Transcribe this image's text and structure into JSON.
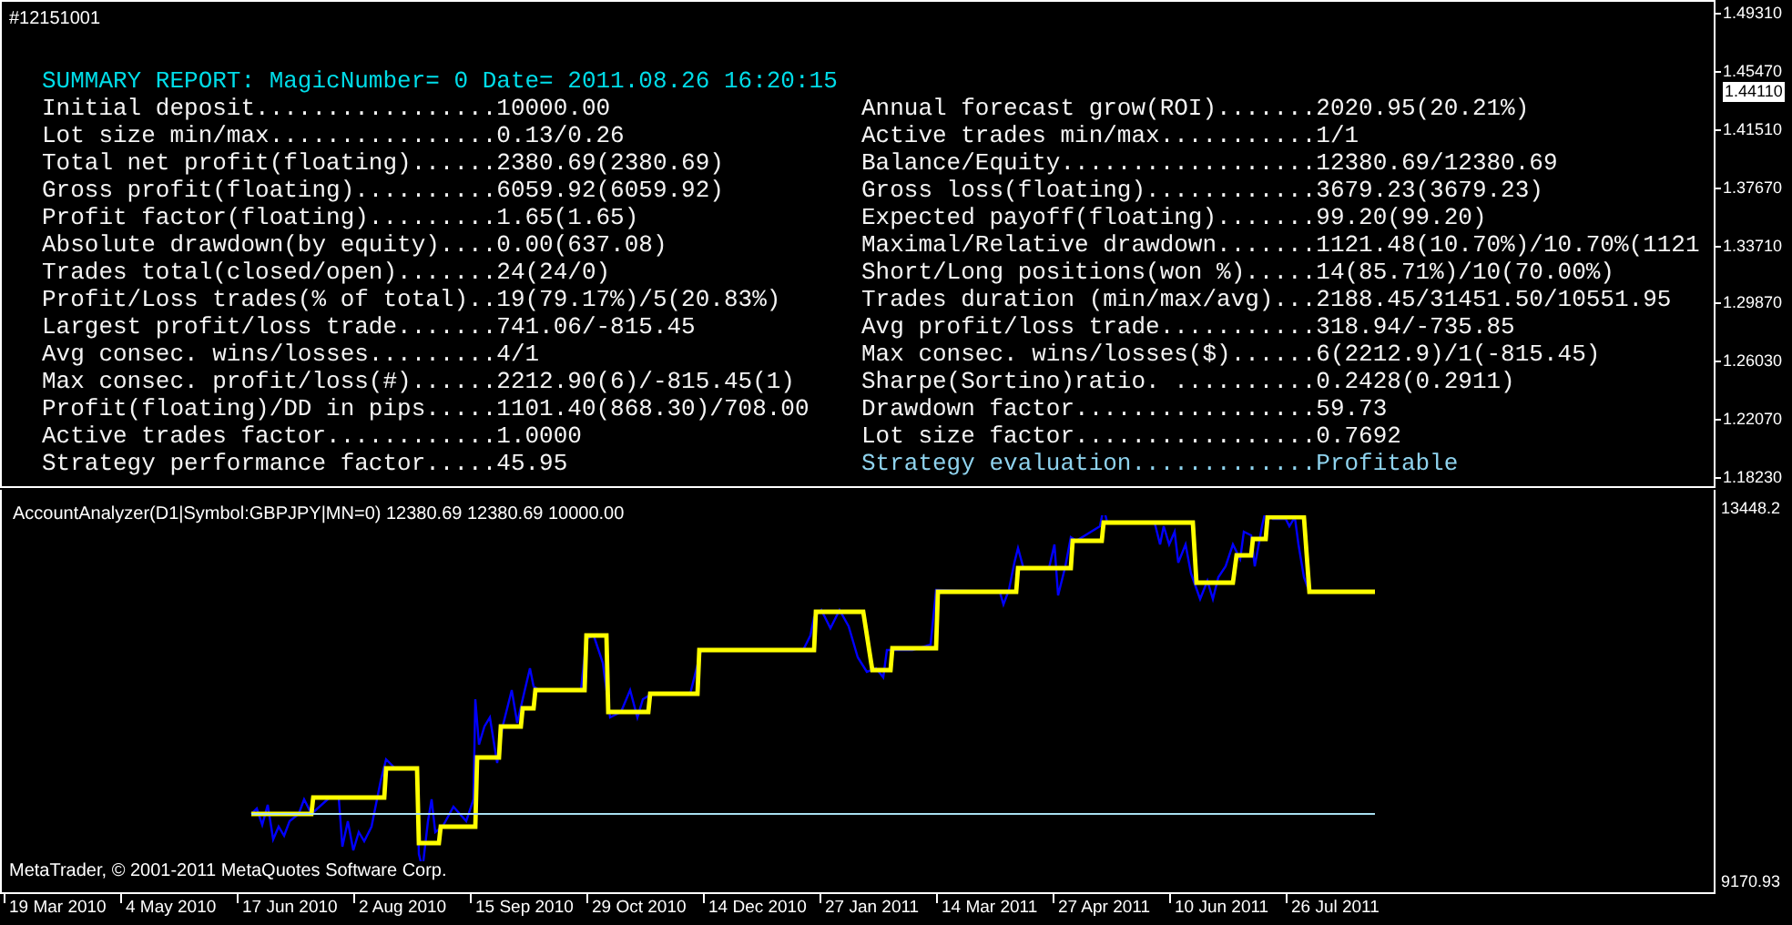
{
  "report": {
    "tag": "#12151001",
    "title": "SUMMARY REPORT: MagicNumber= 0 Date= 2011.08.26 16:20:15",
    "left_rows": [
      {
        "label": "Initial deposit.................",
        "value": "10000.00"
      },
      {
        "label": "Lot size min/max................",
        "value": "0.13/0.26"
      },
      {
        "label": "Total net profit(floating)......",
        "value": "2380.69(2380.69)"
      },
      {
        "label": "Gross profit(floating)..........",
        "value": "6059.92(6059.92)"
      },
      {
        "label": "Profit factor(floating).........",
        "value": "1.65(1.65)"
      },
      {
        "label": "Absolute drawdown(by equity)....",
        "value": "0.00(637.08)"
      },
      {
        "label": "Trades total(closed/open).......",
        "value": "24(24/0)"
      },
      {
        "label": "Profit/Loss trades(% of total)..",
        "value": "19(79.17%)/5(20.83%)"
      },
      {
        "label": "Largest profit/loss trade.......",
        "value": "741.06/-815.45"
      },
      {
        "label": "Avg consec. wins/losses.........",
        "value": "4/1"
      },
      {
        "label": "Max consec. profit/loss(#)......",
        "value": "2212.90(6)/-815.45(1)"
      },
      {
        "label": "Profit(floating)/DD in pips.....",
        "value": "1101.40(868.30)/708.00"
      },
      {
        "label": "Active trades factor............",
        "value": "1.0000"
      },
      {
        "label": "Strategy performance factor.....",
        "value": "45.95"
      }
    ],
    "right_rows": [
      {
        "label": "Annual forecast grow(ROI).......",
        "value": "2020.95(20.21%)",
        "highlighted": false
      },
      {
        "label": "Active trades min/max...........",
        "value": "1/1",
        "highlighted": false
      },
      {
        "label": "Balance/Equity..................",
        "value": "12380.69/12380.69",
        "highlighted": false
      },
      {
        "label": "Gross loss(floating)............",
        "value": "3679.23(3679.23)",
        "highlighted": false
      },
      {
        "label": "Expected payoff(floating).......",
        "value": "99.20(99.20)",
        "highlighted": false
      },
      {
        "label": "Maximal/Relative drawdown.......",
        "value": "1121.48(10.70%)/10.70%(1121",
        "highlighted": false
      },
      {
        "label": "Short/Long positions(won %).....",
        "value": "14(85.71%)/10(70.00%)",
        "highlighted": false
      },
      {
        "label": "Trades duration (min/max/avg)...",
        "value": "2188.45/31451.50/10551.95",
        "highlighted": false
      },
      {
        "label": "Avg profit/loss trade...........",
        "value": "318.94/-735.85",
        "highlighted": false
      },
      {
        "label": "Max consec. wins/losses($)......",
        "value": "6(2212.9)/1(-815.45)",
        "highlighted": false
      },
      {
        "label": "Sharpe(Sortino)ratio. ..........",
        "value": "0.2428(0.2911)",
        "highlighted": false
      },
      {
        "label": "Drawdown factor.................",
        "value": "59.73",
        "highlighted": false
      },
      {
        "label": "Lot size factor.................",
        "value": "0.7692",
        "highlighted": false
      },
      {
        "label": "Strategy evaluation.............",
        "value": "Profitable",
        "highlighted": true
      }
    ]
  },
  "price_axis": [
    {
      "label": "1.49310",
      "current": false
    },
    {
      "label": "1.45470",
      "current": false
    },
    {
      "label": "1.44110",
      "current": true
    },
    {
      "label": "1.41510",
      "current": false
    },
    {
      "label": "1.37670",
      "current": false
    },
    {
      "label": "1.33710",
      "current": false
    },
    {
      "label": "1.29870",
      "current": false
    },
    {
      "label": "1.26030",
      "current": false
    },
    {
      "label": "1.22070",
      "current": false
    },
    {
      "label": "1.18230",
      "current": false
    }
  ],
  "indicator": {
    "label": "AccountAnalyzer(D1|Symbol:GBPJPY|MN=0) 12380.69 12380.69 10000.00",
    "copyright": "MetaTrader, © 2001-2011 MetaQuotes Software Corp.",
    "axis_labels": [
      "13448.2",
      "9170.93"
    ]
  },
  "date_axis": [
    "19 Mar 2010",
    "4 May 2010",
    "17 Jun 2010",
    "2 Aug 2010",
    "15 Sep 2010",
    "29 Oct 2010",
    "14 Dec 2010",
    "27 Jan 2011",
    "14 Mar 2011",
    "27 Apr 2011",
    "10 Jun 2011",
    "26 Jul 2011"
  ]
}
